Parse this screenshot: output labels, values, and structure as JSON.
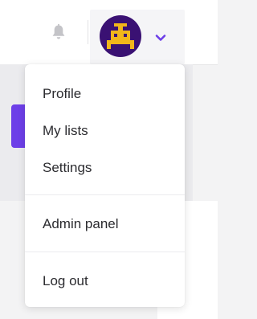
{
  "header": {
    "notifications_icon": "bell-icon",
    "user_menu": {
      "avatar_icon": "pixel-robot-avatar",
      "avatar_bg": "#3a1173",
      "avatar_fg": "#f2b61a",
      "chevron_icon": "chevron-down-icon",
      "chevron_color": "#6d3fe8"
    }
  },
  "background": {
    "accent_button_color": "#6d3fe8"
  },
  "dropdown": {
    "group1": [
      "Profile",
      "My lists",
      "Settings"
    ],
    "group2": [
      "Admin panel"
    ],
    "group3": [
      "Log out"
    ]
  }
}
